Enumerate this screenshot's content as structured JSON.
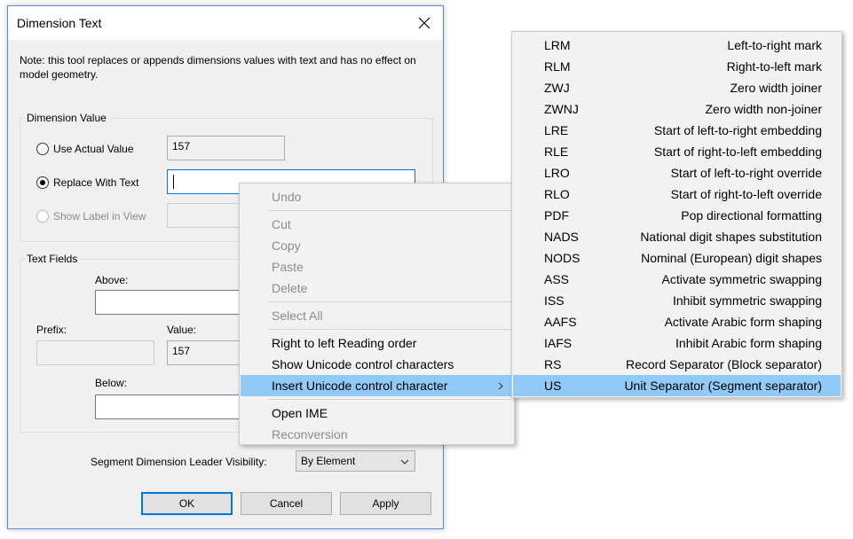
{
  "dialog": {
    "title": "Dimension Text",
    "note": "Note: this tool replaces or appends dimensions values with text and has no effect on model geometry.",
    "dimension_value": {
      "group_label": "Dimension Value",
      "use_actual_label": "Use Actual Value",
      "actual_value": "157",
      "replace_label": "Replace With Text",
      "replace_value": "",
      "show_label": "Show Label in View"
    },
    "text_fields": {
      "group_label": "Text Fields",
      "above_label": "Above:",
      "above_value": "",
      "prefix_label": "Prefix:",
      "prefix_value": "",
      "value_label": "Value:",
      "value_value": "157",
      "below_label": "Below:",
      "below_value": ""
    },
    "segment": {
      "label": "Segment Dimension Leader Visibility:",
      "selected": "By Element"
    },
    "buttons": {
      "ok": "OK",
      "cancel": "Cancel",
      "apply": "Apply"
    }
  },
  "context_menu": {
    "undo": "Undo",
    "cut": "Cut",
    "copy": "Copy",
    "paste": "Paste",
    "delete": "Delete",
    "select_all": "Select All",
    "rtl": "Right to left Reading order",
    "show_unicode": "Show Unicode control characters",
    "insert_unicode": "Insert Unicode control character",
    "open_ime": "Open IME",
    "reconversion": "Reconversion"
  },
  "submenu": [
    {
      "code": "LRM",
      "desc": "Left-to-right mark"
    },
    {
      "code": "RLM",
      "desc": "Right-to-left mark"
    },
    {
      "code": "ZWJ",
      "desc": "Zero width joiner"
    },
    {
      "code": "ZWNJ",
      "desc": "Zero width non-joiner"
    },
    {
      "code": "LRE",
      "desc": "Start of left-to-right embedding"
    },
    {
      "code": "RLE",
      "desc": "Start of right-to-left embedding"
    },
    {
      "code": "LRO",
      "desc": "Start of left-to-right override"
    },
    {
      "code": "RLO",
      "desc": "Start of right-to-left override"
    },
    {
      "code": "PDF",
      "desc": "Pop directional formatting"
    },
    {
      "code": "NADS",
      "desc": "National digit shapes substitution"
    },
    {
      "code": "NODS",
      "desc": "Nominal (European) digit shapes"
    },
    {
      "code": "ASS",
      "desc": "Activate symmetric swapping"
    },
    {
      "code": "ISS",
      "desc": "Inhibit symmetric swapping"
    },
    {
      "code": "AAFS",
      "desc": "Activate Arabic form shaping"
    },
    {
      "code": "IAFS",
      "desc": "Inhibit Arabic form shaping"
    },
    {
      "code": "RS",
      "desc": "Record Separator (Block separator)"
    },
    {
      "code": "US",
      "desc": "Unit Separator (Segment separator)"
    }
  ],
  "colors": {
    "highlight": "#91c9f7",
    "focus": "#0078d7"
  }
}
